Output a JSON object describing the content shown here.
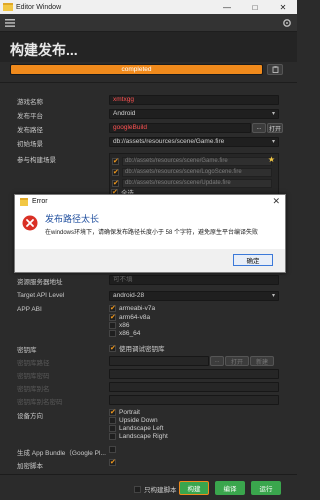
{
  "window": {
    "title": "Editor Window",
    "minimize": "—",
    "maximize": "□",
    "close": "✕"
  },
  "header": {
    "title": "构建发布..."
  },
  "progress": {
    "text": "completed",
    "value": 1.0
  },
  "form": {
    "game_name": {
      "label": "游戏名称",
      "value": "xmtxgg"
    },
    "platform": {
      "label": "发布平台",
      "value": "Android"
    },
    "build_path": {
      "label": "发布路径",
      "value": "googleBuild",
      "dots": "...",
      "open": "打开"
    },
    "start_scene": {
      "label": "初始场景",
      "value": "db://assets/resources/scene/Game.fire"
    },
    "scenes": {
      "label": "参与构建场景",
      "items": [
        "db://assets/resources/scene/Game.fire",
        "db://assets/resources/scene/LogoScene.fire",
        "db://assets/resources/scene/Update.fire"
      ],
      "select_all": "全选"
    },
    "res_server": {
      "label": "资源服务器地址",
      "placeholder": "可不填"
    },
    "target_api": {
      "label": "Target API Level",
      "value": "android-28"
    },
    "app_abi": {
      "label": "APP ABI",
      "options": [
        "armeabi-v7a",
        "arm64-v8a",
        "x86",
        "x86_64"
      ]
    },
    "keystore": {
      "label": "密钥库",
      "debug_label": "使用调试密钥库"
    },
    "keystore_path": {
      "label": "密钥库路径",
      "dots": "...",
      "open": "打开",
      "new": "新建"
    },
    "keystore_password": {
      "label": "密钥库密码"
    },
    "alias": {
      "label": "密钥库别名"
    },
    "alias_password": {
      "label": "密钥库别名密码"
    },
    "orientation": {
      "label": "设备方向",
      "options": [
        "Portrait",
        "Upside Down",
        "Landscape Left",
        "Landscape Right"
      ]
    },
    "app_bundle": {
      "label": "生成 App Bundle（Google Pl..."
    },
    "encrypt": {
      "label": "加密脚本"
    }
  },
  "dialog": {
    "title": "Error",
    "heading": "发布路径太长",
    "message": "在windows环境下，请确保发布路径长度小于 58 个字符，避免原生平台编译失败",
    "ok": "确定",
    "close": "✕"
  },
  "bottom": {
    "script_only": "只构建脚本",
    "build": "构建",
    "compile": "编译",
    "run": "运行"
  },
  "colors": {
    "accent": "#f08a1c",
    "green": "#3aa64d",
    "error": "#ff5252",
    "link_blue": "#1f4e9e"
  }
}
